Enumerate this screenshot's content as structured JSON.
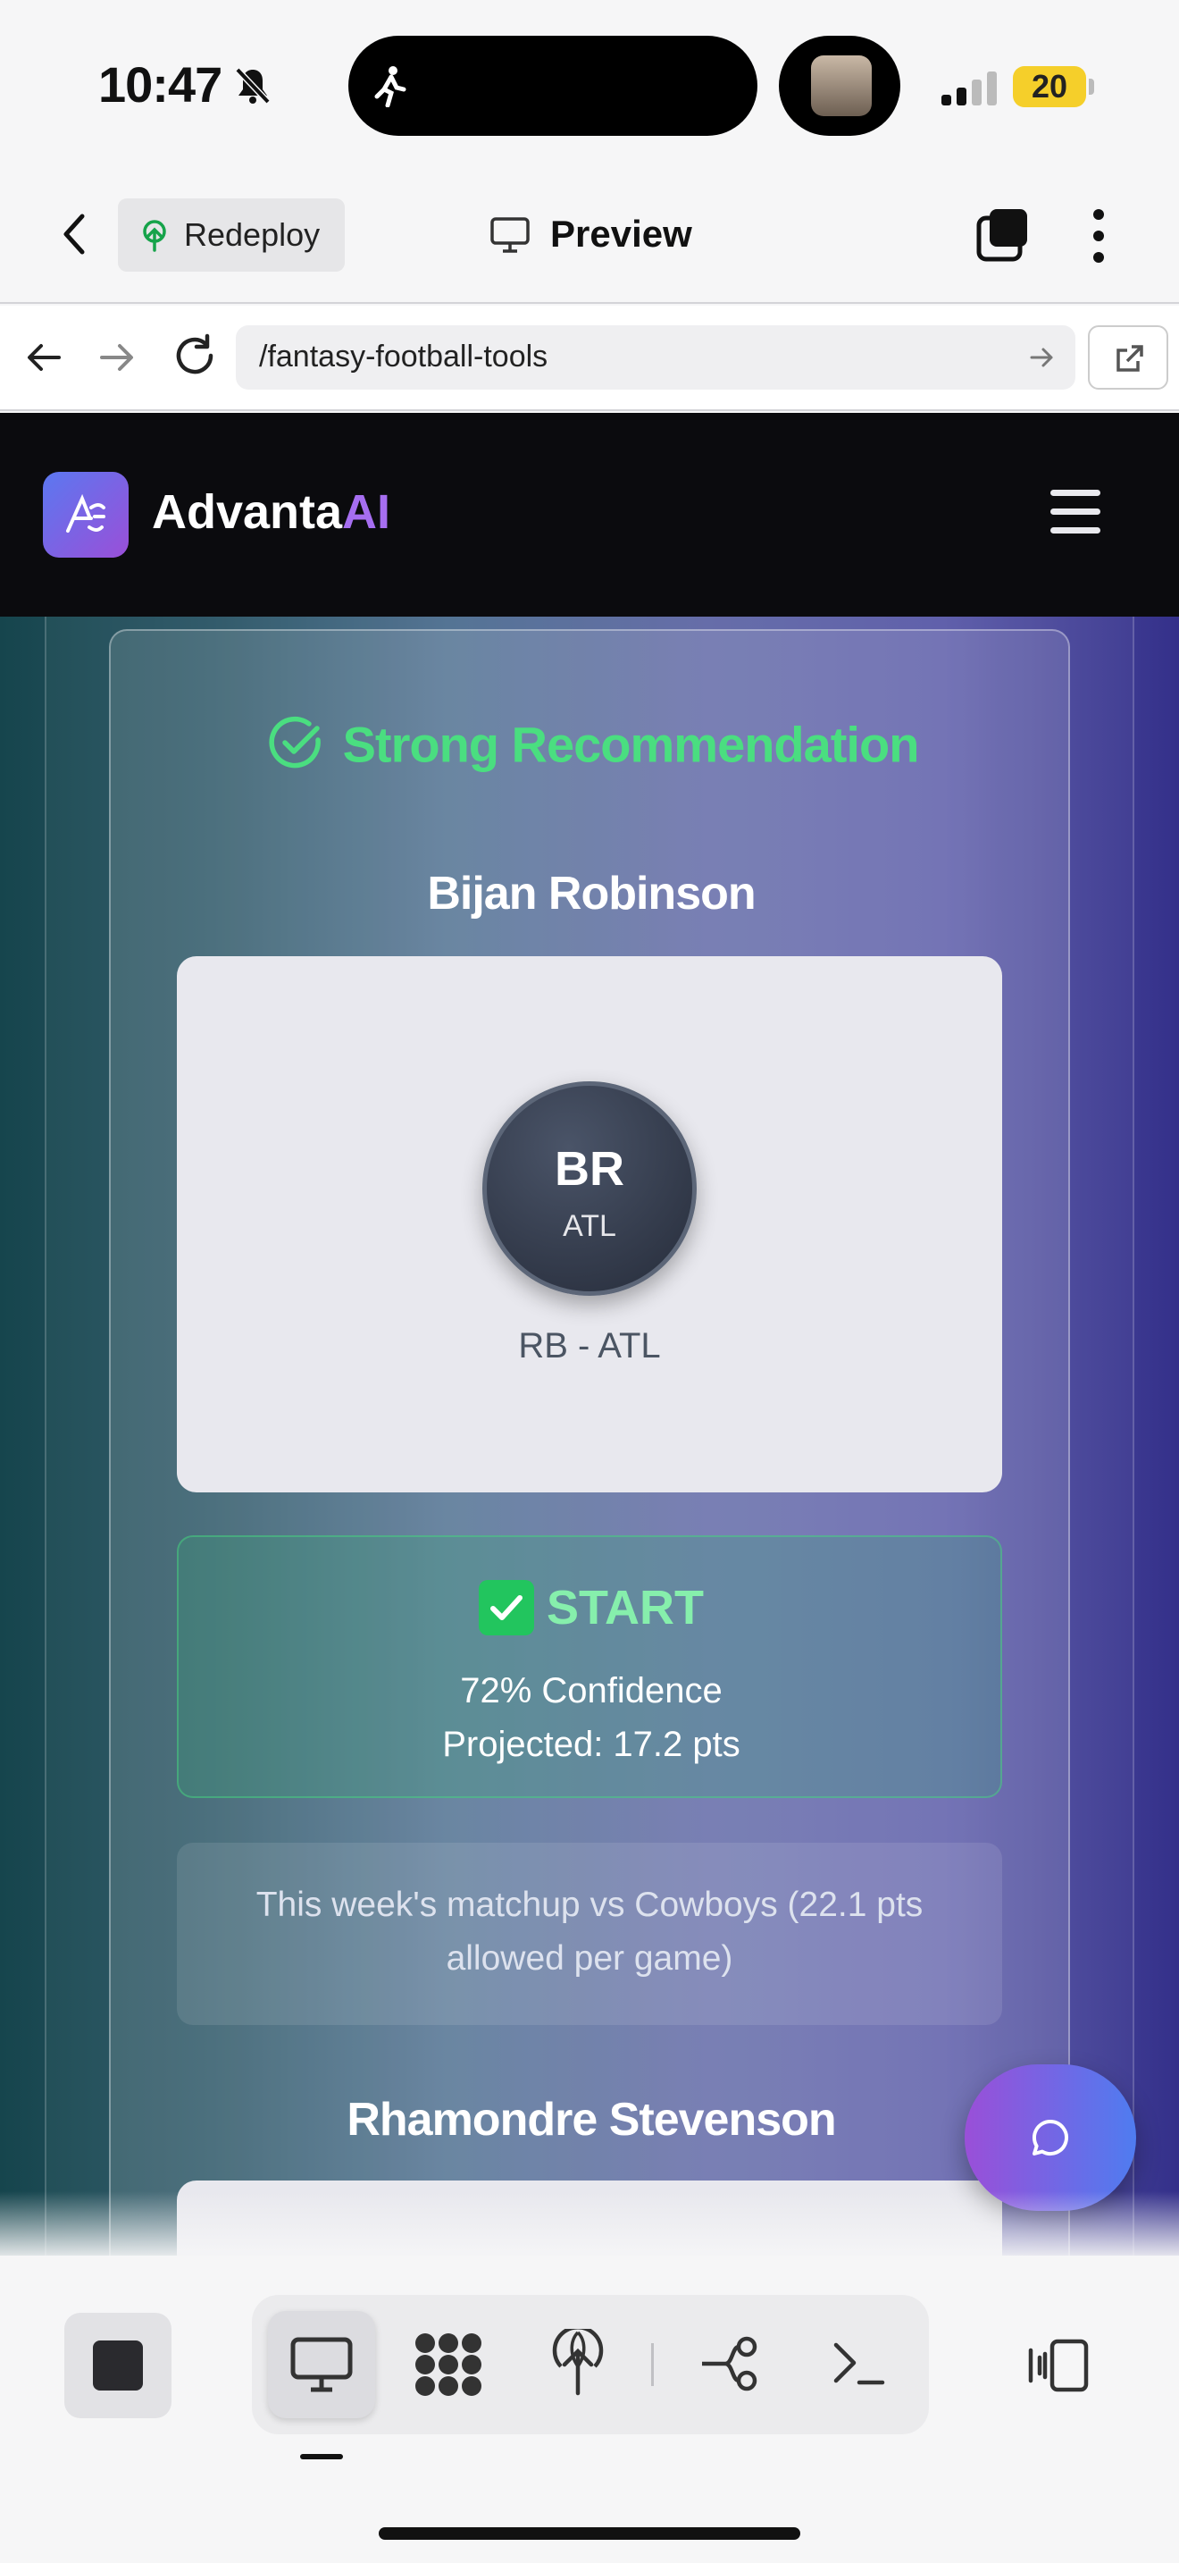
{
  "status_bar": {
    "time": "10:47",
    "battery": "20"
  },
  "app_header": {
    "redeploy_label": "Redeploy",
    "title": "Preview"
  },
  "browser": {
    "url": "/fantasy-football-tools"
  },
  "site": {
    "brand_main": "Advanta",
    "brand_accent": "AI",
    "accent_color": "#a66ef0"
  },
  "recommendation": {
    "header": "Strong Recommendation",
    "header_color": "#4ade80",
    "player": {
      "name": "Bijan Robinson",
      "initials": "BR",
      "team": "ATL",
      "position_team": "RB - ATL"
    },
    "verdict": {
      "label": "START",
      "confidence": "72% Confidence",
      "projected": "Projected: 17.2 pts"
    },
    "note": "This week's matchup vs Cowboys (22.1 pts allowed per game)",
    "next_player": {
      "name": "Rhamondre Stevenson"
    }
  },
  "toolbar": {
    "icons": [
      "stop-icon",
      "desktop-icon",
      "apps-icon",
      "deploy-icon",
      "git-branch-icon",
      "terminal-icon",
      "panel-icon"
    ]
  }
}
